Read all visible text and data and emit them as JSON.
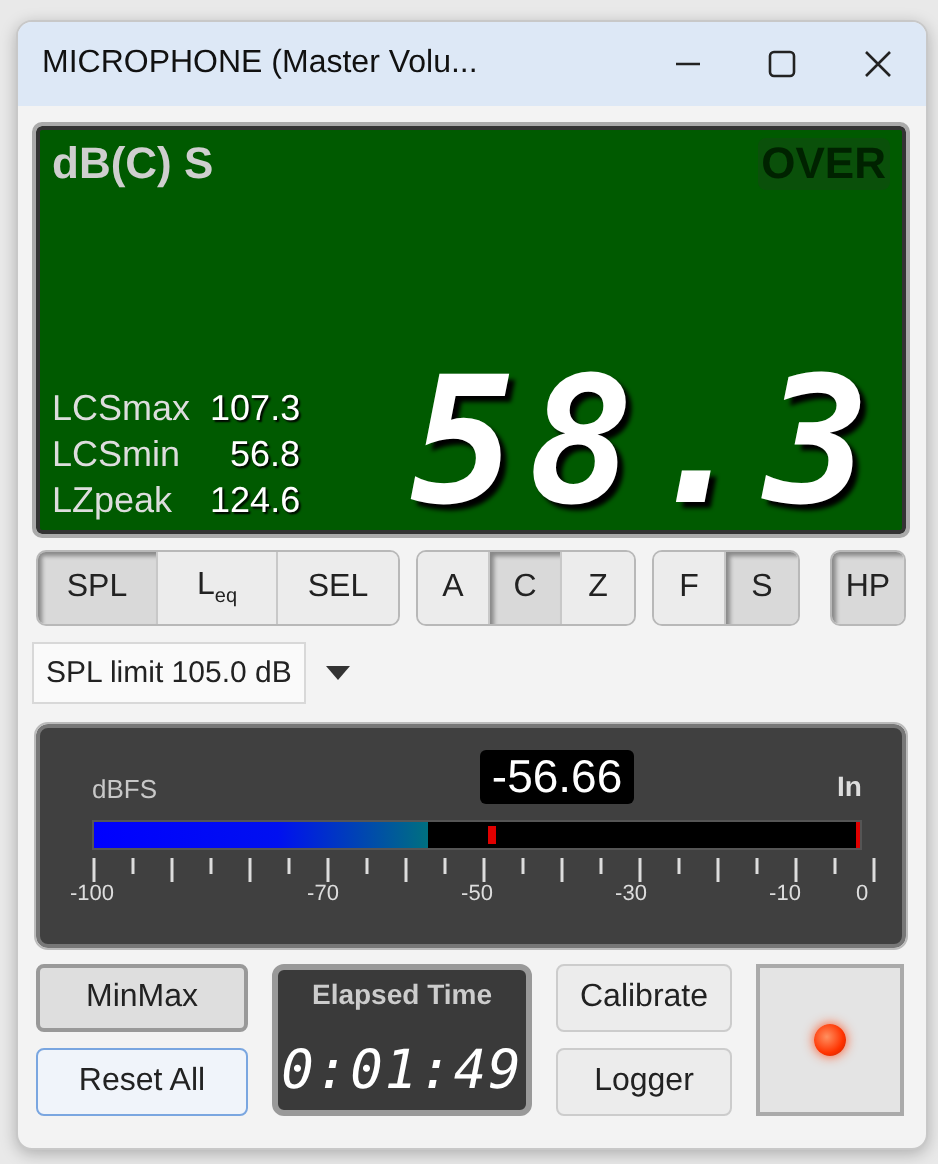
{
  "window": {
    "title": "MICROPHONE (Master Volu..."
  },
  "display": {
    "unit_label": "dB(C) S",
    "over": {
      "label": "OVER",
      "on": false
    },
    "stats": [
      {
        "label": "LCSmax",
        "value": "107.3"
      },
      {
        "label": "LCSmin",
        "value": "56.8"
      },
      {
        "label": "LZpeak",
        "value": "124.6"
      }
    ],
    "reading": "58.3"
  },
  "mode_groups": [
    [
      {
        "label": "SPL",
        "selected": true
      },
      {
        "label": "L$_{eq}$",
        "selected": false
      },
      {
        "label": "SEL",
        "selected": false
      }
    ],
    [
      {
        "label": "A",
        "selected": false
      },
      {
        "label": "C",
        "selected": true
      },
      {
        "label": "Z",
        "selected": false
      }
    ],
    [
      {
        "label": "F",
        "selected": false
      },
      {
        "label": "S",
        "selected": true
      }
    ],
    [
      {
        "label": "HP",
        "selected": true
      }
    ]
  ],
  "limit_dropdown": {
    "value": "SPL limit 105.0 dB"
  },
  "meter": {
    "unit": "dBFS",
    "reading": "-56.66",
    "channel": "In",
    "level": 0.435,
    "peak_hold": {
      "level": 0.515
    },
    "scale": [
      "-100",
      "-70",
      "-50",
      "-30",
      "-10",
      "0"
    ]
  },
  "controls": {
    "min_max": {
      "label": "MinMax",
      "selected": true
    },
    "reset": {
      "label": "Reset All",
      "focused": true
    },
    "elapsed": {
      "title": "Elapsed Time",
      "time": "0:01:49"
    },
    "calibrate": {
      "label": "Calibrate"
    },
    "logger": {
      "label": "Logger"
    },
    "record": {
      "on": true
    }
  }
}
